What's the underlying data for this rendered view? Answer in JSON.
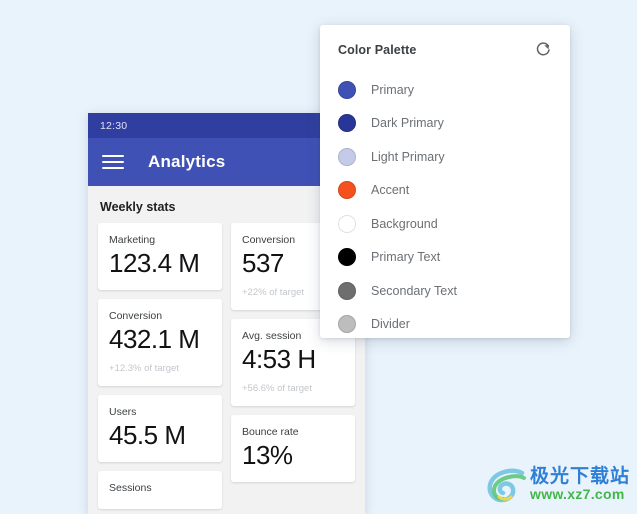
{
  "background": {
    "color": "#e9f3fb"
  },
  "phone": {
    "status_bar": {
      "time": "12:30",
      "wifi_icon": "wifi-icon",
      "bg_color": "#303f9f"
    },
    "app_bar": {
      "menu_icon": "hamburger-menu-icon",
      "title": "Analytics",
      "search_icon": "search-icon",
      "bg_color": "#3f51b5"
    },
    "section_title": "Weekly stats",
    "cards": {
      "left": [
        {
          "label": "Marketing",
          "value": "123.4 M",
          "sub": ""
        },
        {
          "label": "Conversion",
          "value": "432.1 M",
          "sub": "+12.3% of target"
        },
        {
          "label": "Users",
          "value": "45.5 M",
          "sub": ""
        },
        {
          "label": "Sessions",
          "value": "",
          "sub": ""
        }
      ],
      "right": [
        {
          "label": "Conversion",
          "value": "537",
          "sub": "+22% of target"
        },
        {
          "label": "Avg. session",
          "value": "4:53 H",
          "sub": "+56.6% of target"
        },
        {
          "label": "Bounce rate",
          "value": "13%",
          "sub": ""
        }
      ]
    }
  },
  "color_palette": {
    "title": "Color Palette",
    "refresh_icon": "refresh-icon",
    "swatches": [
      {
        "label": "Primary",
        "color": "#3f51b5"
      },
      {
        "label": "Dark Primary",
        "color": "#2a3697"
      },
      {
        "label": "Light Primary",
        "color": "#c5cae9"
      },
      {
        "label": "Accent",
        "color": "#f4511e"
      },
      {
        "label": "Background",
        "color": "#ffffff"
      },
      {
        "label": "Primary Text",
        "color": "#000000"
      },
      {
        "label": "Secondary Text",
        "color": "#6e6e6e"
      },
      {
        "label": "Divider",
        "color": "#bdbdbd"
      }
    ]
  },
  "watermark": {
    "logo_icon": "jiguang-logo-icon",
    "site_name": "极光下载站",
    "url": "www.xz7.com"
  }
}
